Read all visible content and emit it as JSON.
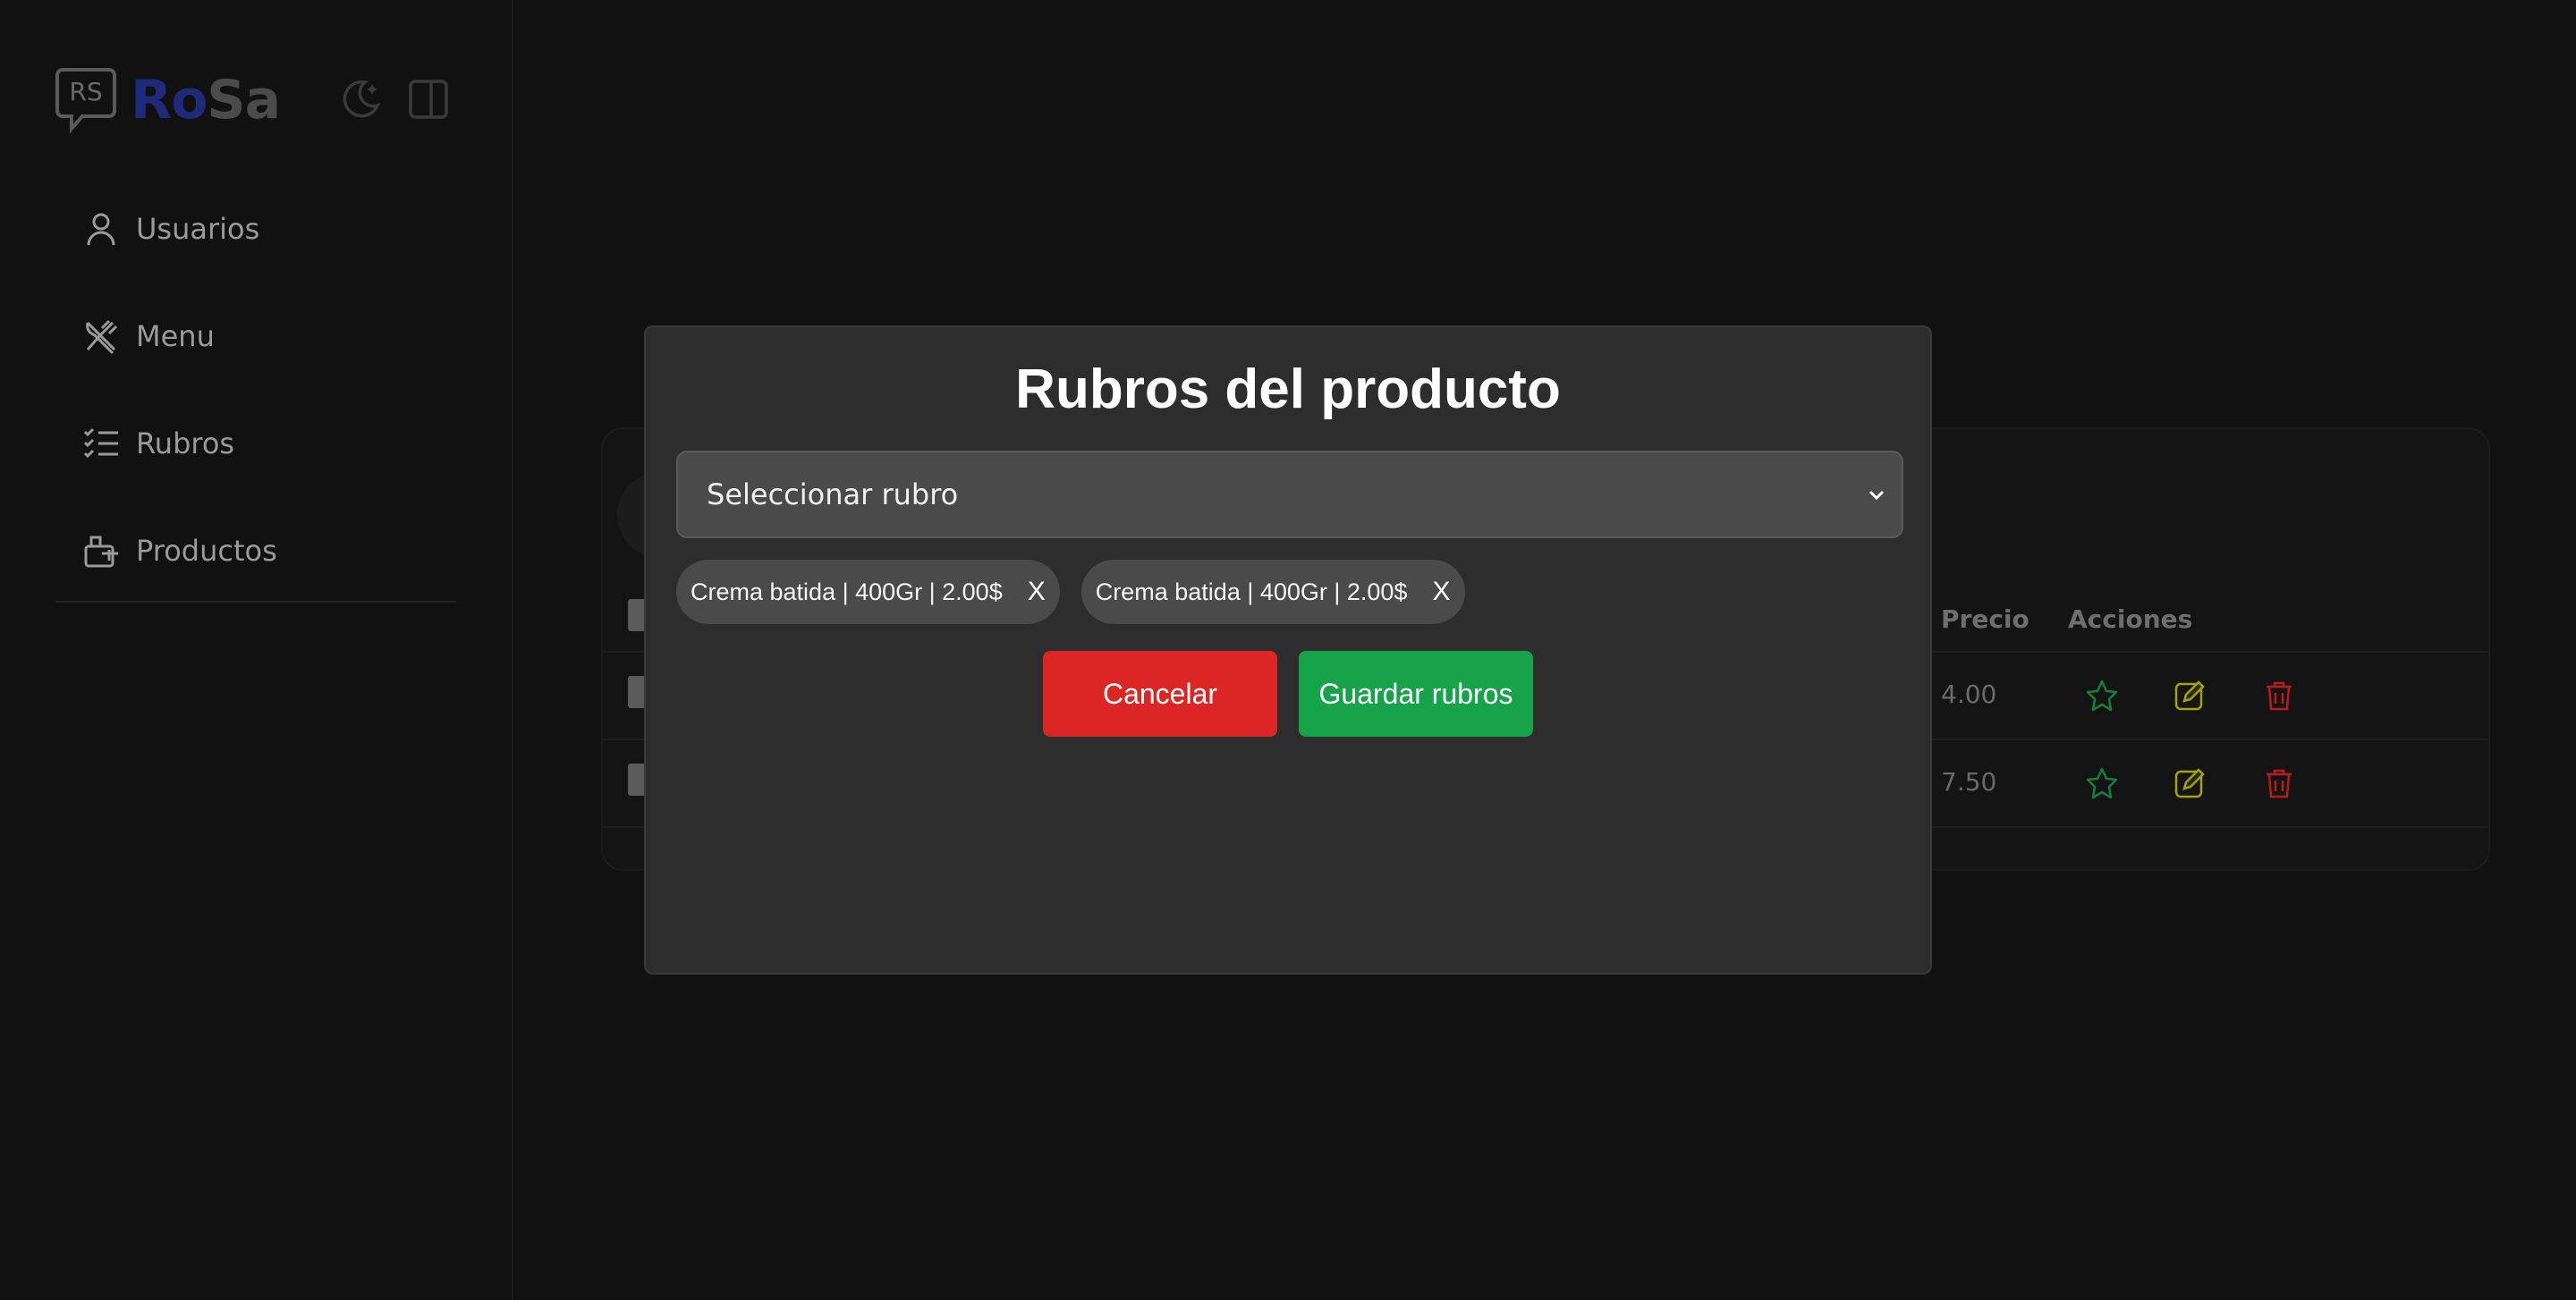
{
  "brand": {
    "logo_text": "RS",
    "name_part1": "Ro",
    "name_part2": "Sa"
  },
  "top_icons": [
    "moon-icon",
    "sidebar-toggle-icon"
  ],
  "sidebar": {
    "items": [
      {
        "label": "Usuarios",
        "icon": "user-icon"
      },
      {
        "label": "Menu",
        "icon": "utensils-icon"
      },
      {
        "label": "Rubros",
        "icon": "checklist-icon"
      },
      {
        "label": "Productos",
        "icon": "box-icon"
      }
    ]
  },
  "table": {
    "headers": {
      "price": "Precio",
      "actions": "Acciones"
    },
    "rows": [
      {
        "price": "4.00"
      },
      {
        "price": "7.50"
      }
    ],
    "action_icons": [
      "star-icon",
      "edit-icon",
      "trash-icon"
    ],
    "colors": {
      "star": "#15803d",
      "edit": "#a3a30f",
      "trash": "#b91c1c"
    }
  },
  "modal": {
    "title": "Rubros del producto",
    "select_placeholder": "Seleccionar rubro",
    "chips": [
      {
        "label": "Crema batida | 400Gr | 2.00$",
        "remove": "X"
      },
      {
        "label": "Crema batida | 400Gr | 2.00$",
        "remove": "X"
      }
    ],
    "cancel_label": "Cancelar",
    "save_label": "Guardar rubros",
    "colors": {
      "cancel": "#dc2626",
      "save": "#16a34a"
    }
  }
}
